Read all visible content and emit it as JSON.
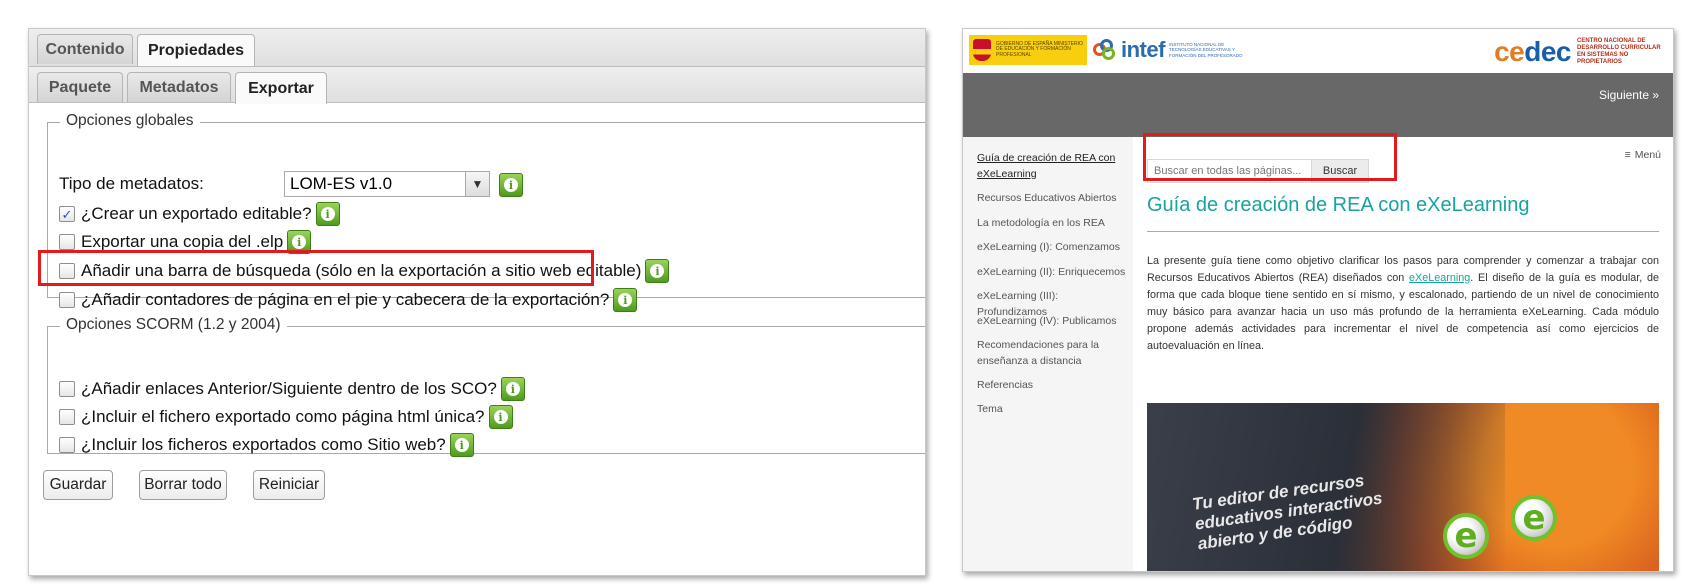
{
  "left": {
    "tabs_top": [
      {
        "label": "Contenido",
        "active": false
      },
      {
        "label": "Propiedades",
        "active": true
      }
    ],
    "tabs_sub": [
      {
        "label": "Paquete",
        "active": false
      },
      {
        "label": "Metadatos",
        "active": false
      },
      {
        "label": "Exportar",
        "active": true
      }
    ],
    "global": {
      "legend": "Opciones globales",
      "metadata_label": "Tipo de metadatos:",
      "metadata_value": "LOM-ES v1.0",
      "options": [
        {
          "label": "¿Crear un exportado editable?",
          "checked": true
        },
        {
          "label": "Exportar una copia del .elp",
          "checked": false
        },
        {
          "label": "Añadir una barra de búsqueda (sólo en la exportación a sitio web editable)",
          "checked": false,
          "highlighted": true
        },
        {
          "label": "¿Añadir contadores de página en el pie y cabecera de la exportación?",
          "checked": false
        }
      ]
    },
    "scorm": {
      "legend": "Opciones SCORM (1.2 y 2004)",
      "options": [
        {
          "label": "¿Añadir enlaces Anterior/Siguiente dentro de los SCO?",
          "checked": false
        },
        {
          "label": "¿Incluir el fichero exportado como página html única?",
          "checked": false
        },
        {
          "label": "¿Incluir los ficheros exportados como Sitio web?",
          "checked": false
        }
      ]
    },
    "buttons": {
      "save": "Guardar",
      "clear": "Borrar todo",
      "reset": "Reiniciar"
    },
    "check_glyph": "✓",
    "info_glyph": "i"
  },
  "right": {
    "header": {
      "gov_text": "GOBIERNO DE ESPAÑA   MINISTERIO DE EDUCACIÓN Y FORMACIÓN PROFESIONAL",
      "intef_word": "intef",
      "intef_sub": "INSTITUTO NACIONAL DE TECNOLOGÍAS EDUCATIVAS Y FORMACIÓN DEL PROFESORADO",
      "cedec_word_a": "ce",
      "cedec_word_b": "dec",
      "cedec_sub": "CENTRO NACIONAL DE DESARROLLO CURRICULAR EN SISTEMAS NO PROPIETARIOS"
    },
    "next_link": "Siguiente »",
    "menu_label": "Menú",
    "nav": [
      {
        "label": "Guía de creación de REA con eXeLearning",
        "active": true
      },
      {
        "label": "Recursos Educativos Abiertos",
        "active": false
      },
      {
        "label": "La metodología en los REA",
        "active": false
      },
      {
        "label": "eXeLearning (I): Comenzamos",
        "active": false
      },
      {
        "label": "eXeLearning (II): Enriquecemos",
        "active": false
      },
      {
        "label": "eXeLearning (III): Profundizamos",
        "active": false
      },
      {
        "label": "eXeLearning (IV): Publicamos",
        "active": false
      },
      {
        "label": "Recomendaciones para la enseñanza a distancia",
        "active": false
      },
      {
        "label": "Referencias",
        "active": false
      },
      {
        "label": "Tema",
        "active": false
      }
    ],
    "search": {
      "placeholder": "Buscar en todas las páginas...",
      "button": "Buscar"
    },
    "title": "Guía de creación de REA con eXeLearning",
    "para_before": "La presente guía tiene como objetivo clarificar los pasos para comprender y comenzar a trabajar con Recursos Educativos Abiertos (REA) diseñados con ",
    "para_link": "eXeLearning",
    "para_after": ". El diseño de la guía es modular, de forma que cada bloque tiene sentido en sí mismo, y escalonado, partiendo de un nivel de conocimiento muy  básico para avanzar hacia un uso más profundo de la herramienta eXeLearning. Cada módulo propone además actividades para incrementar el nivel de competencia así como ejercicios de autoevaluación en línea.",
    "image_caption": "Tu editor de recursos\neducativos interactivos\nabierto y de código",
    "image_logo_glyph": "e"
  },
  "colors": {
    "highlight": "#e11b1b",
    "teal_title": "#18a3a0",
    "band_grey": "#686868",
    "info_green": "#4f9b1f"
  }
}
